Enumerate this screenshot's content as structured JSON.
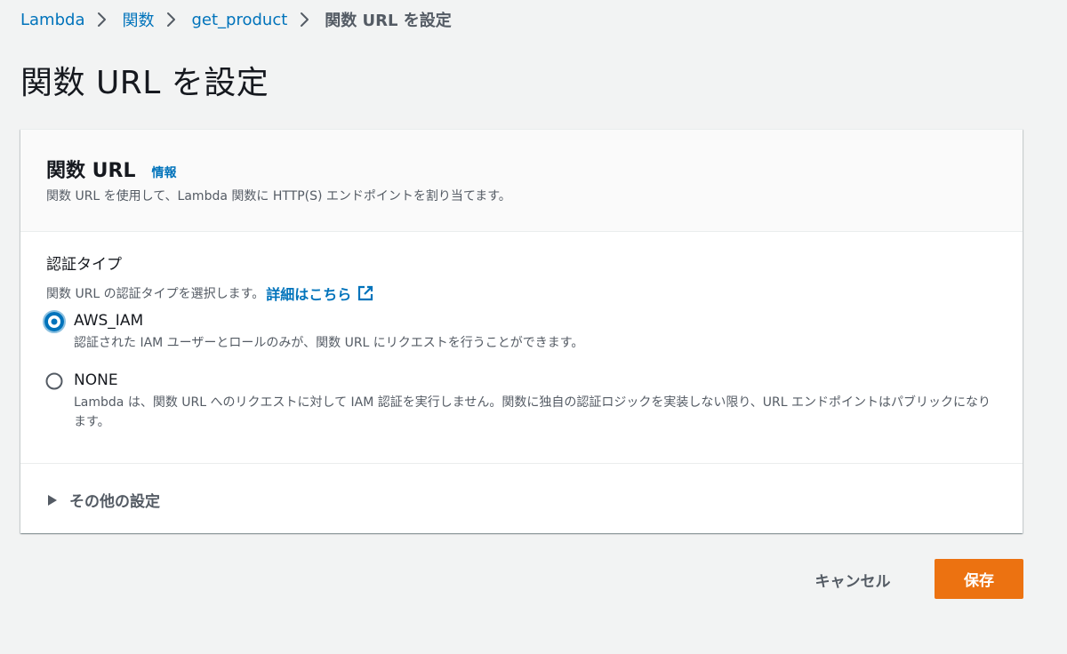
{
  "breadcrumb": {
    "items": [
      {
        "label": "Lambda"
      },
      {
        "label": "関数"
      },
      {
        "label": "get_product"
      }
    ],
    "current": "関数 URL を設定"
  },
  "page": {
    "title": "関数 URL を設定"
  },
  "panel": {
    "title": "関数 URL",
    "info_link": "情報",
    "description": "関数 URL を使用して、Lambda 関数に HTTP(S) エンドポイントを割り当てます。"
  },
  "auth": {
    "label": "認証タイプ",
    "description": "関数 URL の認証タイプを選択します。",
    "learn_more": "詳細はこちら",
    "selected": "AWS_IAM",
    "options": [
      {
        "label": "AWS_IAM",
        "description": "認証された IAM ユーザーとロールのみが、関数 URL にリクエストを行うことができます。",
        "checked": true
      },
      {
        "label": "NONE",
        "description": "Lambda は、関数 URL へのリクエストに対して IAM 認証を実行しません。関数に独自の認証ロジックを実装しない限り、URL エンドポイントはパブリックになります。",
        "checked": false
      }
    ]
  },
  "additional_settings": {
    "label": "その他の設定",
    "expanded": false
  },
  "footer": {
    "cancel_label": "キャンセル",
    "save_label": "保存"
  },
  "colors": {
    "link": "#0073bb",
    "primary_button": "#ec7211",
    "radio_selected": "#0073bb",
    "background": "#f2f3f3"
  },
  "icons": {
    "breadcrumb_separator": "chevron-right-icon",
    "external_link": "external-link-icon",
    "expander": "caret-right-icon"
  }
}
